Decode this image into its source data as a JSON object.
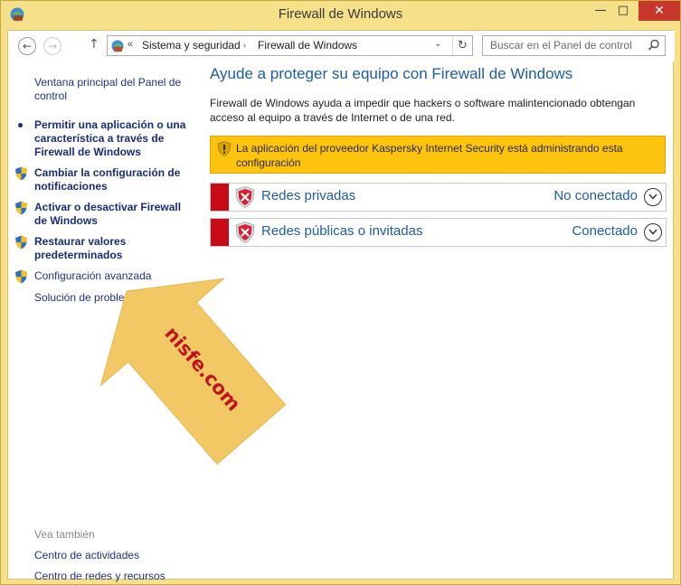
{
  "window": {
    "title": "Firewall de Windows",
    "min_glyph": "—",
    "max_glyph": "□",
    "close_glyph": "✕"
  },
  "nav": {
    "back_glyph": "←",
    "forward_glyph": "→",
    "up_glyph": "↑",
    "address_sep": "«",
    "breadcrumb": [
      "Sistema y seguridad",
      "Firewall de Windows"
    ],
    "crumb_arrow": "›",
    "dropdown_glyph": "⌄",
    "refresh_glyph": "↻",
    "search_placeholder": "Buscar en el Panel de control"
  },
  "sidebar": {
    "home_link": "Ventana principal del Panel de control",
    "items": [
      {
        "label": "Permitir una aplicación o una característica a través de Firewall de Windows",
        "icon": "bullet"
      },
      {
        "label": "Cambiar la configuración de notificaciones",
        "icon": "uac-shield-icon"
      },
      {
        "label": "Activar o desactivar Firewall de Windows",
        "icon": "uac-shield-icon"
      },
      {
        "label": "Restaurar valores predeterminados",
        "icon": "uac-shield-icon"
      },
      {
        "label": "Configuración avanzada",
        "icon": "uac-shield-icon"
      },
      {
        "label": "Solución de problemas de red",
        "icon": "none"
      }
    ],
    "see_also_label": "Vea también",
    "see_also": [
      {
        "label": "Centro de actividades"
      },
      {
        "label": "Centro de redes y recursos compartidos"
      }
    ]
  },
  "main": {
    "heading": "Ayude a proteger su equipo con Firewall de Windows",
    "description": "Firewall de Windows ayuda a impedir que hackers o software malintencionado obtengan acceso al equipo a través de Internet o de una red.",
    "notice": "La aplicación del proveedor Kaspersky Internet Security está administrando esta configuración",
    "networks": [
      {
        "name": "Redes privadas",
        "status": "No conectado"
      },
      {
        "name": "Redes públicas o invitadas",
        "status": "Conectado"
      }
    ]
  },
  "watermark": {
    "text": "nisfe.com",
    "arrow_color": "#f2c865",
    "text_color": "#c1121f"
  },
  "colors": {
    "frame": "#f6e089",
    "link": "#1f5ca8",
    "alert_red": "#c90a17",
    "notice_bg": "#fcc40f"
  }
}
